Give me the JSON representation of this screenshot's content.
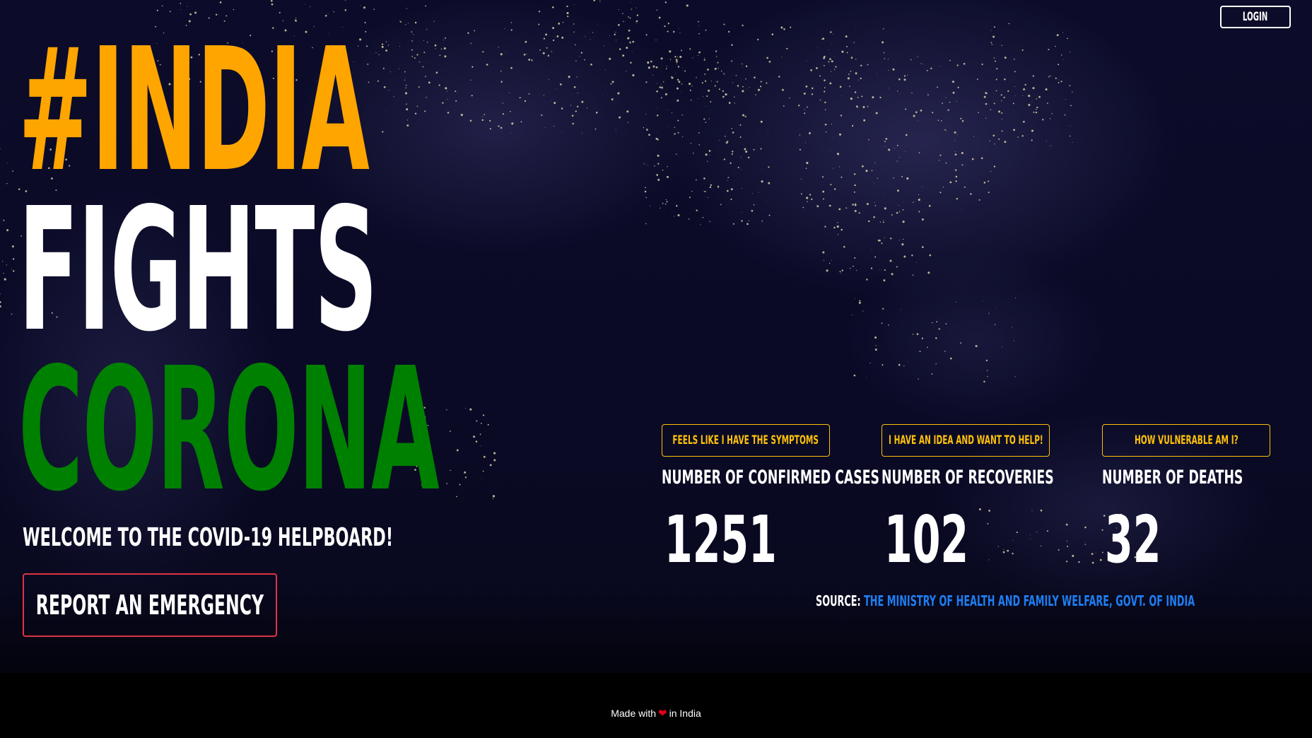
{
  "header": {
    "login_label": "Login"
  },
  "headline": {
    "line1": "#INDIA",
    "line2": "FIGHTS",
    "line3": "CORONA"
  },
  "welcome": "Welcome to the COVID-19 Helpboard!",
  "report_button": "Report an Emergency",
  "stats": [
    {
      "button": "Feels like I have the symptoms",
      "label": "Number of Confirmed Cases",
      "value": "1251"
    },
    {
      "button": "I have an idea and want to help!",
      "label": "Number of Recoveries",
      "value": "102"
    },
    {
      "button": "How vulnerable am I?",
      "label": "Number of Deaths",
      "value": "32"
    }
  ],
  "source": {
    "label": "Source:",
    "link_text": "The Ministry of Health and Family Welfare, Govt. of India"
  },
  "footer": {
    "prefix": "Made with",
    "heart_icon": "heart-icon",
    "suffix": "in India"
  },
  "colors": {
    "saffron": "#ffa500",
    "white": "#ffffff",
    "green": "#008000",
    "warning": "#ffc107",
    "danger": "#dc3545",
    "link": "#1e7ef0"
  }
}
